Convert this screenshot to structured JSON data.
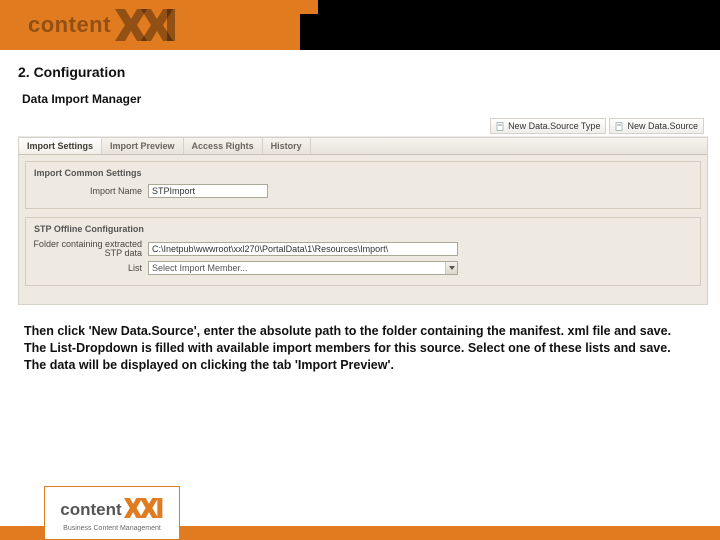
{
  "banner": {
    "logo_text": "content"
  },
  "page": {
    "title": "2. Configuration",
    "subtitle": "Data Import Manager"
  },
  "toolbar": {
    "new_type_label": "New Data.Source Type",
    "new_source_label": "New Data.Source"
  },
  "tabs": {
    "items": [
      {
        "label": "Import Settings"
      },
      {
        "label": "Import Preview"
      },
      {
        "label": "Access Rights"
      },
      {
        "label": "History"
      }
    ]
  },
  "fieldset_common": {
    "legend": "Import Common Settings",
    "import_name_label": "Import Name",
    "import_name_value": "STPImport"
  },
  "fieldset_stp": {
    "legend": "STP Offline Configuration",
    "folder_label": "Folder containing extracted STP data",
    "folder_value": "C:\\Inetpub\\wwwroot\\xxl270\\PortalData\\1\\Resources\\Import\\",
    "list_label": "List",
    "list_value": "Select Import Member..."
  },
  "instructions": {
    "text": "Then click 'New Data.Source', enter the absolute path to the folder containing the manifest. xml file and save. The List-Dropdown is filled with available import members for this source. Select one of these lists and save. The data will be displayed on clicking the tab 'Import Preview'."
  },
  "footer_logo": {
    "text": "content",
    "tagline": "Business Content Management"
  }
}
